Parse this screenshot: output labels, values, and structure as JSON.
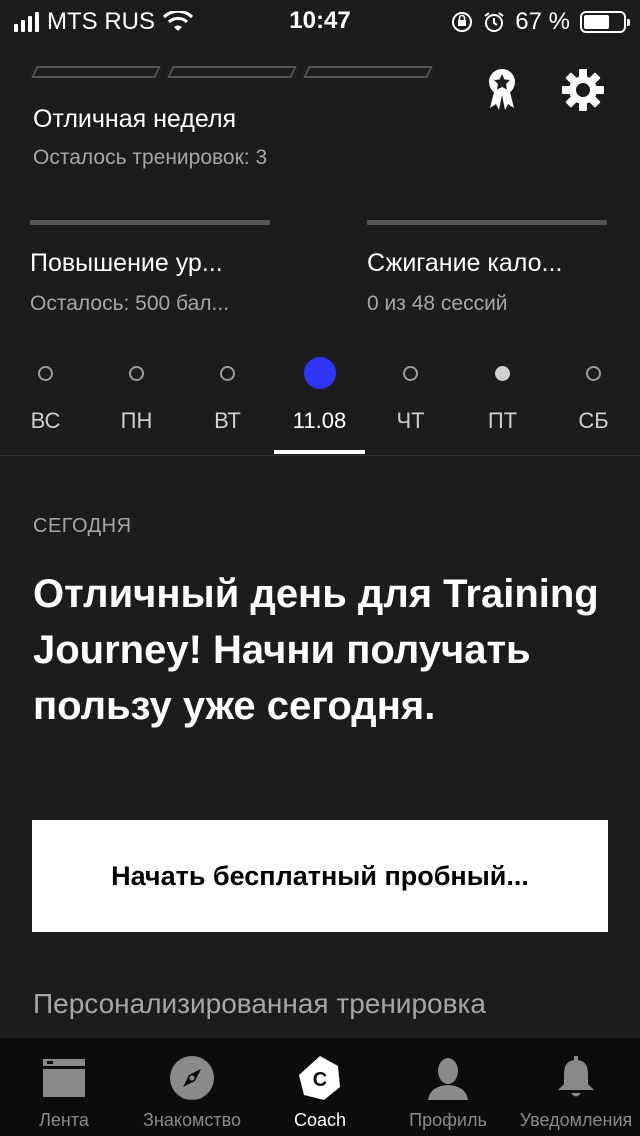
{
  "status_bar": {
    "carrier": "MTS RUS",
    "time": "10:47",
    "battery": "67 %"
  },
  "header": {
    "week_title": "Отличная неделя",
    "week_subtitle": "Осталось тренировок: 3"
  },
  "goals": [
    {
      "title": "Повышение ур...",
      "subtitle": "Осталось: 500 бал..."
    },
    {
      "title": "Сжигание кало...",
      "subtitle": "0 из 48 сессий"
    }
  ],
  "week": {
    "days": [
      {
        "label": "ВС",
        "state": "empty"
      },
      {
        "label": "ПН",
        "state": "empty"
      },
      {
        "label": "ВТ",
        "state": "empty"
      },
      {
        "label": "11.08",
        "state": "active"
      },
      {
        "label": "ЧТ",
        "state": "empty"
      },
      {
        "label": "ПТ",
        "state": "filled"
      },
      {
        "label": "СБ",
        "state": "empty"
      }
    ],
    "selected_index": 3
  },
  "main": {
    "today_label": "СЕГОДНЯ",
    "headline": "Отличный день для Training Journey! Начни получать пользу уже сегодня.",
    "trial_button": "Начать бесплатный пробный...",
    "personal_title": "Персонализированная тренировка"
  },
  "tabs": [
    {
      "label": "Лента",
      "icon": "feed-icon"
    },
    {
      "label": "Знакомство",
      "icon": "compass-icon"
    },
    {
      "label": "Coach",
      "icon": "coach-icon"
    },
    {
      "label": "Профиль",
      "icon": "profile-icon"
    },
    {
      "label": "Уведомления",
      "icon": "bell-icon"
    }
  ],
  "colors": {
    "background": "#1c1c1e",
    "accent": "#2e35f5",
    "tab_bar": "#0c0c0c"
  }
}
